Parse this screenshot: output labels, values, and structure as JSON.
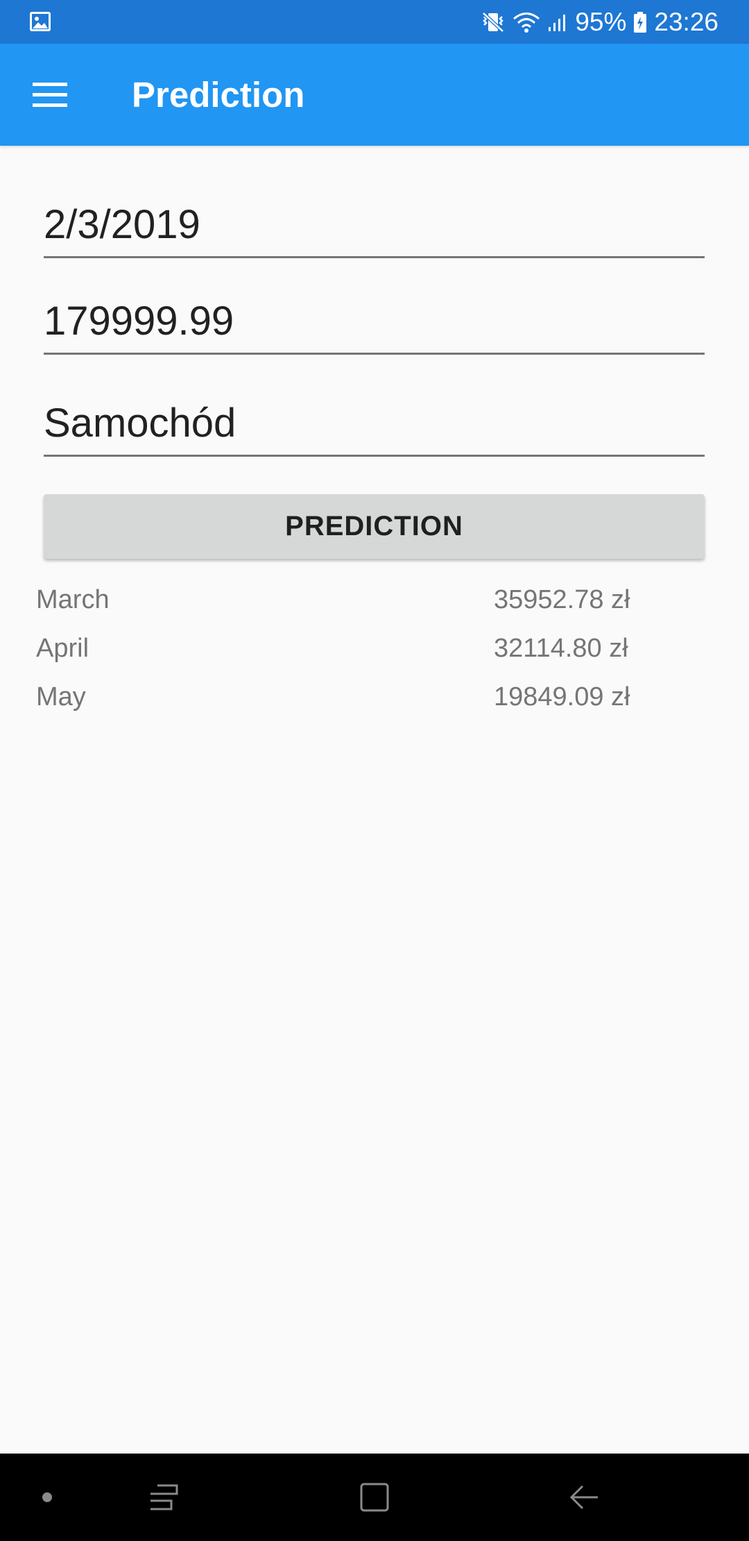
{
  "status_bar": {
    "battery": "95%",
    "time": "23:26"
  },
  "app_bar": {
    "title": "Prediction"
  },
  "form": {
    "date_value": "2/3/2019",
    "amount_value": "179999.99",
    "category_value": "Samochód",
    "button_label": "PREDICTION"
  },
  "results": [
    {
      "month": "March",
      "amount": "35952.78 zł"
    },
    {
      "month": "April",
      "amount": "32114.80 zł"
    },
    {
      "month": "May",
      "amount": "19849.09 zł"
    }
  ],
  "colors": {
    "status_bar": "#1e77d3",
    "app_bar": "#2196f3",
    "button": "#d6d7d7",
    "background": "#fafafa",
    "result_text": "#757575"
  },
  "icons": {
    "status_left": "gallery-icon",
    "status_right": [
      "vibrate-icon",
      "wifi-icon",
      "signal-icon",
      "battery-charging-icon"
    ],
    "app_bar": "hamburger-menu-icon",
    "nav": [
      "dot-icon",
      "recent-apps-icon",
      "home-icon",
      "back-icon"
    ]
  }
}
